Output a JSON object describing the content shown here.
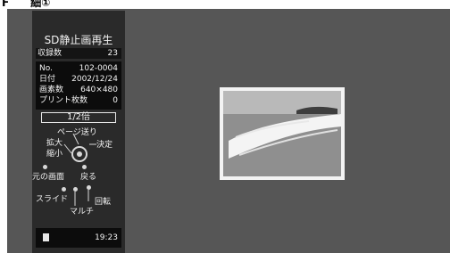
{
  "topbar": {
    "heading_fragment": "F　　細①"
  },
  "sidebar": {
    "mode_title": "SD静止画再生",
    "count_label": "収録数",
    "count_value": "23",
    "info": {
      "no_label": "No.",
      "no_value": "102-0004",
      "date_label": "日付",
      "date_value": "2002/12/24",
      "pixels_label": "画素数",
      "pixels_value": "640×480",
      "prints_label": "プリント枚数",
      "prints_value": "0"
    },
    "zoom_value": "1/2倍",
    "controls": {
      "page_forward": "ページ送り",
      "zoom_in": "拡大",
      "zoom_out": "縮小",
      "enter": "決定",
      "original_screen": "元の画面",
      "back": "戻る",
      "slide": "スライド",
      "rotate": "回転",
      "multi": "マルチ"
    },
    "status": {
      "card_icon": "sd-card-icon",
      "time": "19:23"
    }
  },
  "photo": {
    "description": "beach-photo"
  }
}
